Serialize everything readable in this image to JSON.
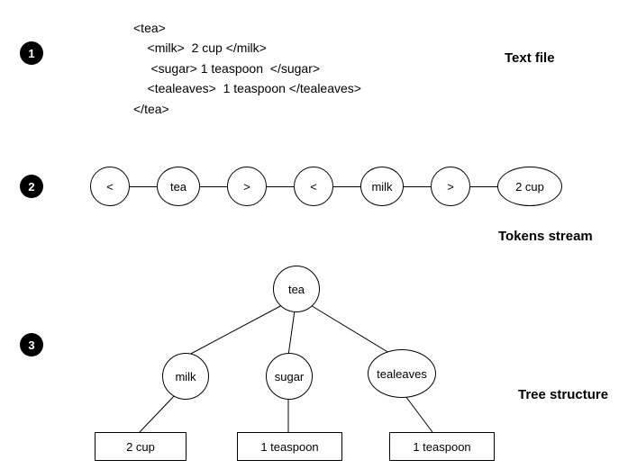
{
  "steps": {
    "s1": "1",
    "s2": "2",
    "s3": "3"
  },
  "labels": {
    "text_file": "Text file",
    "tokens_stream": "Tokens  stream",
    "tree_structure": "Tree structure"
  },
  "code": "<tea>\n    <milk>  2 cup </milk>\n     <sugar> 1 teaspoon  </sugar>\n    <tealeaves>  1 teaspoon </tealeaves>\n</tea>",
  "tokens": {
    "t0": "<",
    "t1": "tea",
    "t2": ">",
    "t3": "<",
    "t4": "milk",
    "t5": ">",
    "t6": "2 cup"
  },
  "tree": {
    "root": "tea",
    "c1": "milk",
    "c2": "sugar",
    "c3": "tealeaves",
    "l1": "2 cup",
    "l2": "1 teaspoon",
    "l3": "1 teaspoon"
  }
}
